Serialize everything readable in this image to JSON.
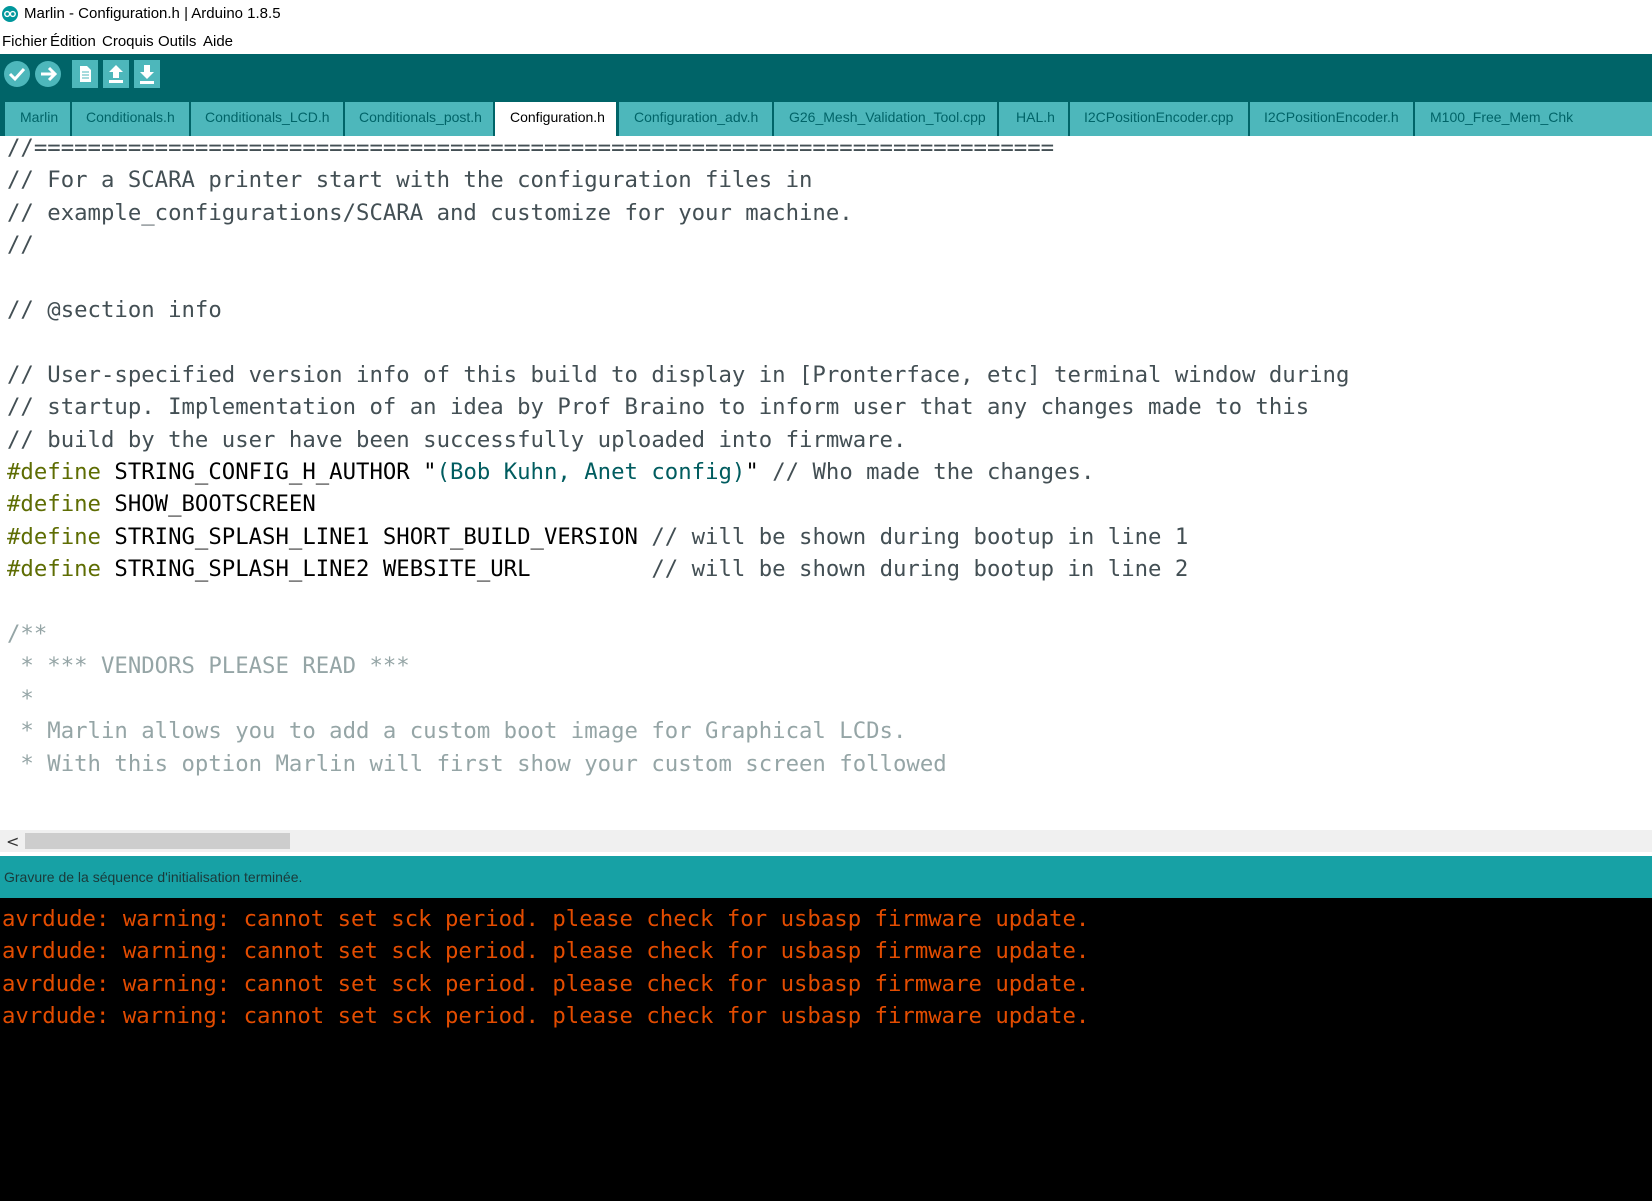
{
  "window": {
    "title": "Marlin - Configuration.h | Arduino 1.8.5"
  },
  "menu": [
    "Fichier",
    "Édition",
    "Croquis",
    "Outils",
    "Aide"
  ],
  "toolbar": {
    "buttons": [
      "verify-icon",
      "upload-icon",
      "new-icon",
      "open-icon",
      "save-icon"
    ]
  },
  "tabs": [
    "Marlin",
    "Conditionals.h",
    "Conditionals_LCD.h",
    "Conditionals_post.h",
    "Configuration.h",
    "Configuration_adv.h",
    "G26_Mesh_Validation_Tool.cpp",
    "HAL.h",
    "I2CPositionEncoder.cpp",
    "I2CPositionEncoder.h",
    "M100_Free_Mem_Chk"
  ],
  "active_tab": "Configuration.h",
  "editor": {
    "lines": [
      [
        {
          "t": "//============================================================================",
          "c": "comment"
        }
      ],
      [
        {
          "t": "// For a SCARA printer start with the configuration files in",
          "c": "comment"
        }
      ],
      [
        {
          "t": "// example_configurations/SCARA and customize for your machine.",
          "c": "comment"
        }
      ],
      [
        {
          "t": "//",
          "c": "comment"
        }
      ],
      [],
      [
        {
          "t": "// @section info",
          "c": "comment"
        }
      ],
      [],
      [
        {
          "t": "// User-specified version info of this build to display in [Pronterface, etc] terminal window during",
          "c": "comment"
        }
      ],
      [
        {
          "t": "// startup. Implementation of an idea by Prof Braino to inform user that any changes made to this",
          "c": "comment"
        }
      ],
      [
        {
          "t": "// build by the user have been successfully uploaded into firmware.",
          "c": "comment"
        }
      ],
      [
        {
          "t": "#define",
          "c": "kw"
        },
        {
          "t": " STRING_CONFIG_H_AUTHOR ",
          "c": "text"
        },
        {
          "t": "\"",
          "c": "text"
        },
        {
          "t": "(Bob Kuhn, Anet config)",
          "c": "str"
        },
        {
          "t": "\"",
          "c": "text"
        },
        {
          "t": " // Who made the changes.",
          "c": "comment"
        }
      ],
      [
        {
          "t": "#define",
          "c": "kw"
        },
        {
          "t": " SHOW_BOOTSCREEN",
          "c": "text"
        }
      ],
      [
        {
          "t": "#define",
          "c": "kw"
        },
        {
          "t": " STRING_SPLASH_LINE1 SHORT_BUILD_VERSION ",
          "c": "text"
        },
        {
          "t": "// will be shown during bootup in line 1",
          "c": "comment"
        }
      ],
      [
        {
          "t": "#define",
          "c": "kw"
        },
        {
          "t": " STRING_SPLASH_LINE2 WEBSITE_URL         ",
          "c": "text"
        },
        {
          "t": "// will be shown during bootup in line 2",
          "c": "comment"
        }
      ],
      [],
      [
        {
          "t": "/**",
          "c": "doc"
        }
      ],
      [
        {
          "t": " * *** VENDORS PLEASE READ ***",
          "c": "doc"
        }
      ],
      [
        {
          "t": " *",
          "c": "doc"
        }
      ],
      [
        {
          "t": " * Marlin allows you to add a custom boot image for Graphical LCDs.",
          "c": "doc"
        }
      ],
      [
        {
          "t": " * With this option Marlin will first show your custom screen followed",
          "c": "doc"
        }
      ]
    ]
  },
  "status": {
    "message": "Gravure de la séquence d'initialisation terminée."
  },
  "console": {
    "lines": [
      "avrdude: warning: cannot set sck period. please check for usbasp firmware update.",
      "avrdude: warning: cannot set sck period. please check for usbasp firmware update.",
      "avrdude: warning: cannot set sck period. please check for usbasp firmware update.",
      "avrdude: warning: cannot set sck period. please check for usbasp firmware update."
    ]
  },
  "colors": {
    "toolbar_bg": "#006468",
    "tab_bg": "#4db7bb",
    "status_bg": "#17a1a5",
    "console_text": "#e34c00",
    "keyword": "#5e6d03"
  }
}
